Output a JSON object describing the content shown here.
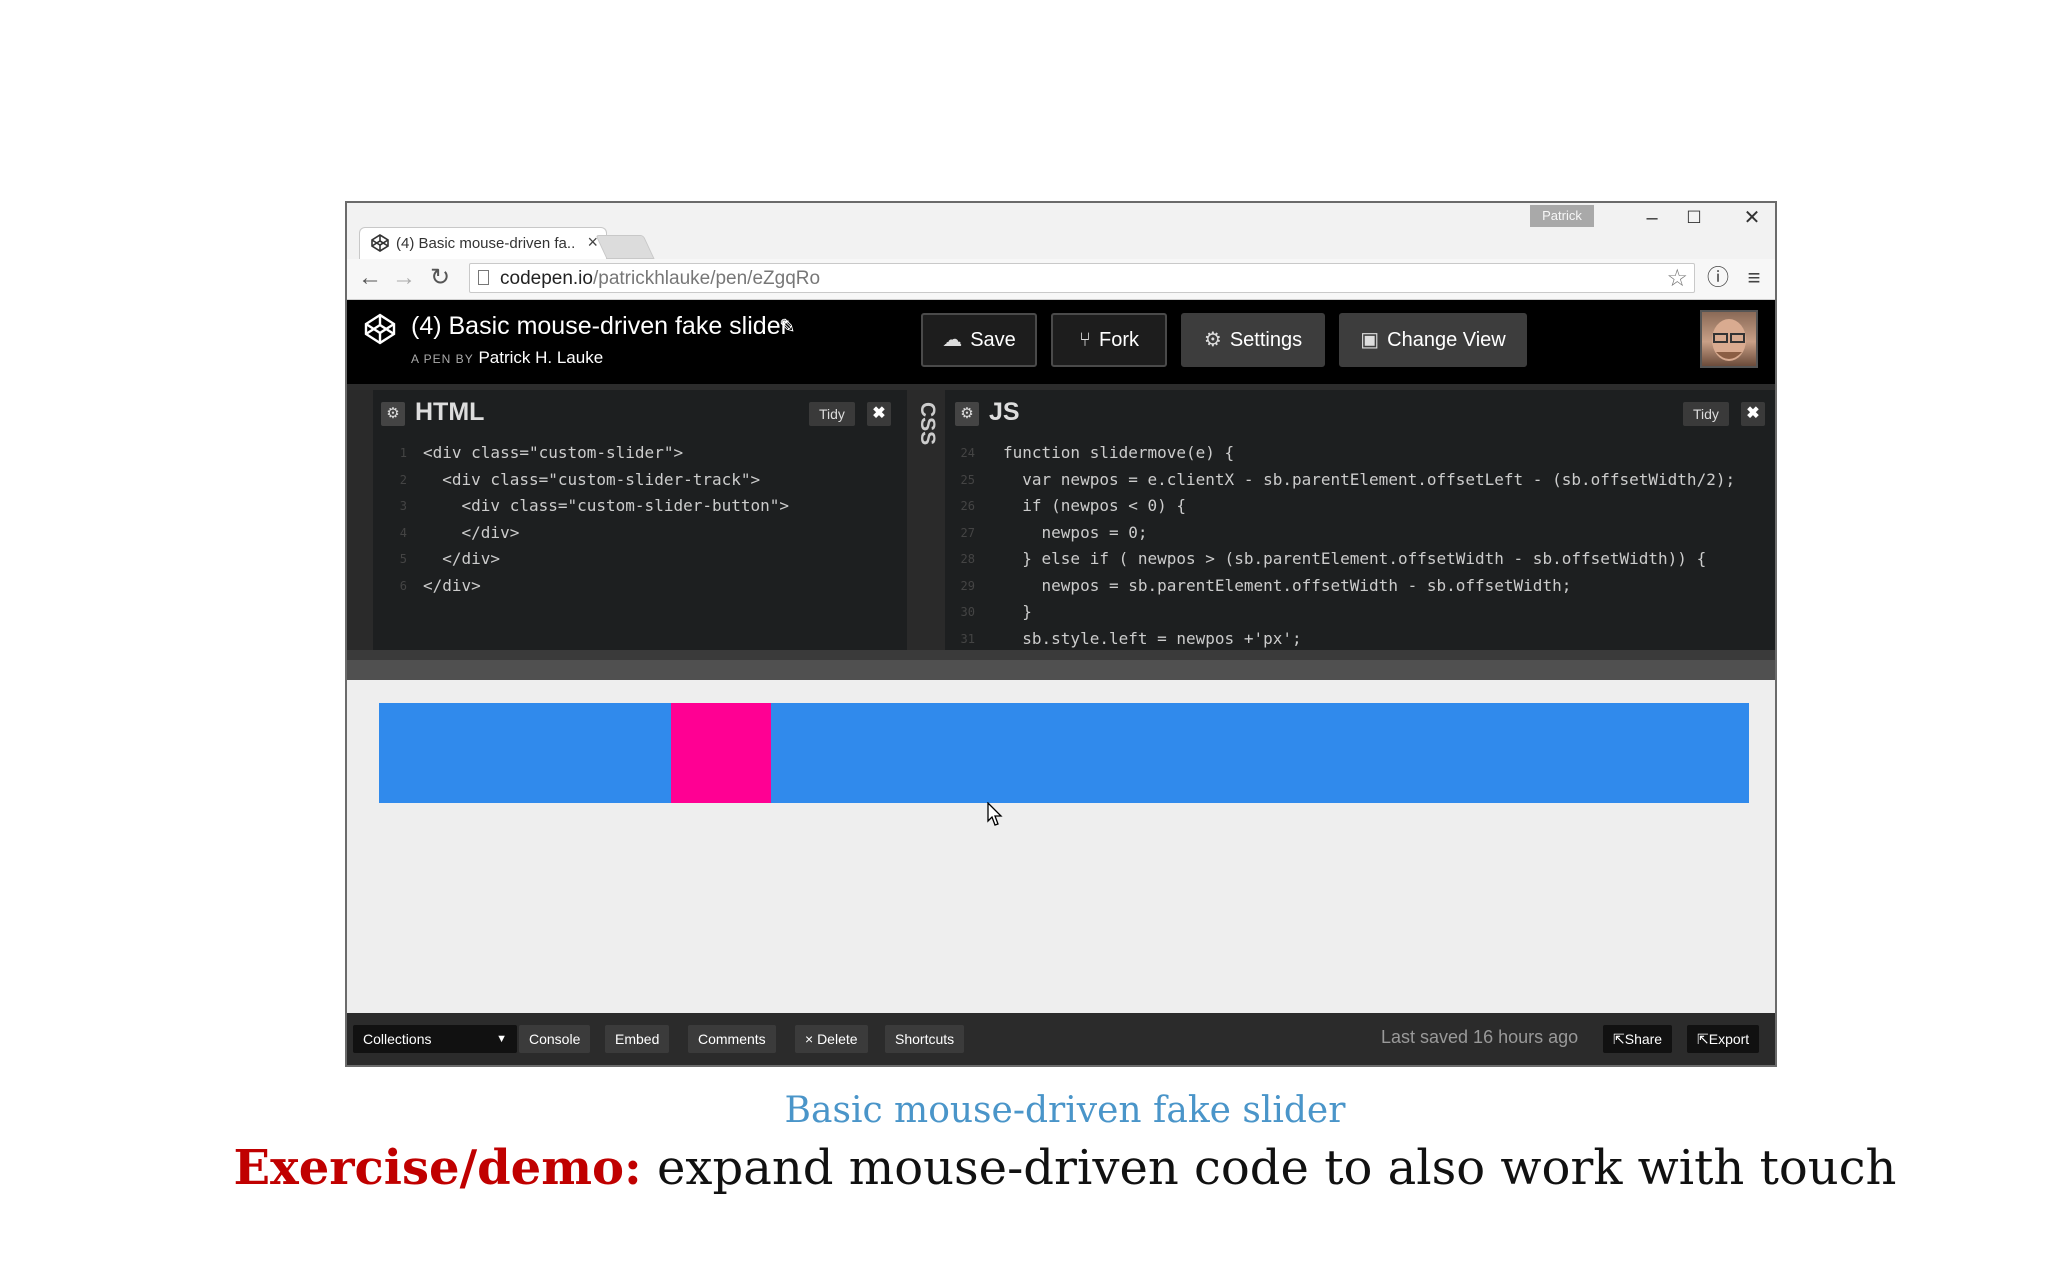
{
  "browser": {
    "tab_title": "(4) Basic mouse-driven fa...",
    "tab_close": "×",
    "user_badge": "Patrick",
    "window_minimize": "–",
    "window_maximize": "☐",
    "window_close": "✕",
    "url_host": "codepen.io",
    "url_path": "/patrickhlauke/pen/eZgqRo"
  },
  "codepen": {
    "pen_title": "(4) Basic mouse-driven fake slider",
    "byline_prefix": "A PEN BY",
    "author": "Patrick H. Lauke",
    "buttons": {
      "save": "Save",
      "fork": "Fork",
      "settings": "Settings",
      "change_view": "Change View"
    }
  },
  "editors": {
    "html": {
      "title": "HTML",
      "tidy": "Tidy",
      "line_numbers": [
        "1",
        "2",
        "3",
        "4",
        "5",
        "6"
      ]
    },
    "css": {
      "title": "CSS"
    },
    "js": {
      "title": "JS",
      "tidy": "Tidy",
      "line_numbers": [
        "24",
        "25",
        "26",
        "27",
        "28",
        "29",
        "30",
        "31"
      ]
    }
  },
  "html_code": [
    "<div class=\"custom-slider\">",
    "  <div class=\"custom-slider-track\">",
    "    <div class=\"custom-slider-button\">",
    "    </div>",
    "  </div>",
    "</div>"
  ],
  "js_code": [
    "function slidermove(e) {",
    "  var newpos = e.clientX - sb.parentElement.offsetLeft - (sb.offsetWidth/2);",
    "  if (newpos < 0) {",
    "    newpos = 0;",
    "  } else if ( newpos > (sb.parentElement.offsetWidth - sb.offsetWidth)) {",
    "    newpos = sb.parentElement.offsetWidth - sb.offsetWidth;",
    "  }",
    "  sb.style.left = newpos +'px';"
  ],
  "preview": {
    "track_color": "#308aec",
    "button_color": "#ff0093",
    "slider_position_fraction": 0.213
  },
  "footer": {
    "collections": "Collections",
    "console": "Console",
    "embed": "Embed",
    "comments": "Comments",
    "delete": "× Delete",
    "shortcuts": "Shortcuts",
    "last_saved": "Last saved 16 hours ago",
    "share": "Share",
    "export": "Export"
  },
  "caption": {
    "subtitle": "Basic mouse-driven fake slider",
    "highlight": "Exercise/demo:",
    "text": " expand mouse-driven code to also work with touch"
  }
}
